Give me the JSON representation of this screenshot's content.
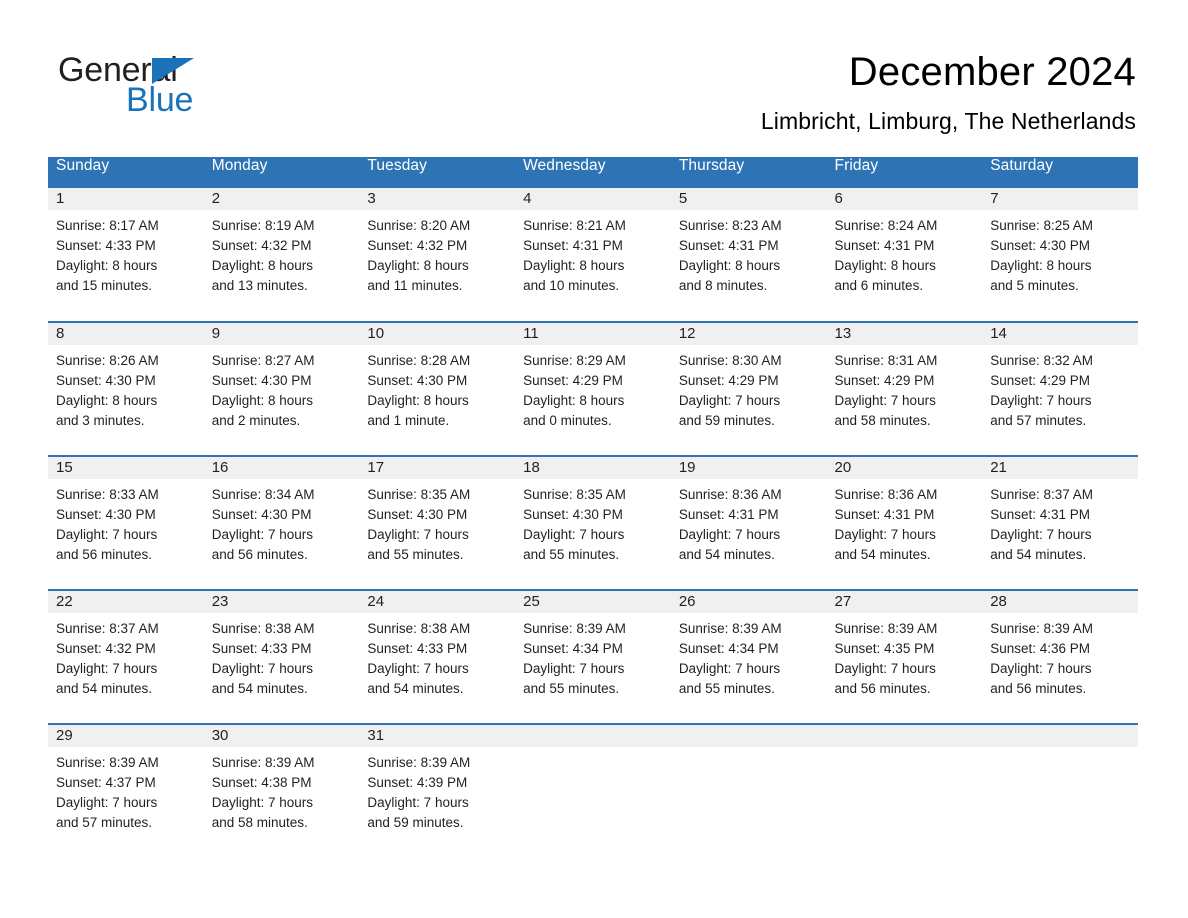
{
  "brand": {
    "name_part1": "General",
    "name_part2": "Blue",
    "triangle_color": "#1b72b8"
  },
  "header": {
    "title": "December 2024",
    "subtitle": "Limbricht, Limburg, The Netherlands"
  },
  "theme": {
    "header_blue": "#2e74b5",
    "daynum_band": "#f0f0f0",
    "text": "#231f20"
  },
  "calendar": {
    "weekday_headers": [
      "Sunday",
      "Monday",
      "Tuesday",
      "Wednesday",
      "Thursday",
      "Friday",
      "Saturday"
    ],
    "weeks": [
      [
        {
          "day": "1",
          "sunrise": "Sunrise: 8:17 AM",
          "sunset": "Sunset: 4:33 PM",
          "daylight_line1": "Daylight: 8 hours",
          "daylight_line2": "and 15 minutes."
        },
        {
          "day": "2",
          "sunrise": "Sunrise: 8:19 AM",
          "sunset": "Sunset: 4:32 PM",
          "daylight_line1": "Daylight: 8 hours",
          "daylight_line2": "and 13 minutes."
        },
        {
          "day": "3",
          "sunrise": "Sunrise: 8:20 AM",
          "sunset": "Sunset: 4:32 PM",
          "daylight_line1": "Daylight: 8 hours",
          "daylight_line2": "and 11 minutes."
        },
        {
          "day": "4",
          "sunrise": "Sunrise: 8:21 AM",
          "sunset": "Sunset: 4:31 PM",
          "daylight_line1": "Daylight: 8 hours",
          "daylight_line2": "and 10 minutes."
        },
        {
          "day": "5",
          "sunrise": "Sunrise: 8:23 AM",
          "sunset": "Sunset: 4:31 PM",
          "daylight_line1": "Daylight: 8 hours",
          "daylight_line2": "and 8 minutes."
        },
        {
          "day": "6",
          "sunrise": "Sunrise: 8:24 AM",
          "sunset": "Sunset: 4:31 PM",
          "daylight_line1": "Daylight: 8 hours",
          "daylight_line2": "and 6 minutes."
        },
        {
          "day": "7",
          "sunrise": "Sunrise: 8:25 AM",
          "sunset": "Sunset: 4:30 PM",
          "daylight_line1": "Daylight: 8 hours",
          "daylight_line2": "and 5 minutes."
        }
      ],
      [
        {
          "day": "8",
          "sunrise": "Sunrise: 8:26 AM",
          "sunset": "Sunset: 4:30 PM",
          "daylight_line1": "Daylight: 8 hours",
          "daylight_line2": "and 3 minutes."
        },
        {
          "day": "9",
          "sunrise": "Sunrise: 8:27 AM",
          "sunset": "Sunset: 4:30 PM",
          "daylight_line1": "Daylight: 8 hours",
          "daylight_line2": "and 2 minutes."
        },
        {
          "day": "10",
          "sunrise": "Sunrise: 8:28 AM",
          "sunset": "Sunset: 4:30 PM",
          "daylight_line1": "Daylight: 8 hours",
          "daylight_line2": "and 1 minute."
        },
        {
          "day": "11",
          "sunrise": "Sunrise: 8:29 AM",
          "sunset": "Sunset: 4:29 PM",
          "daylight_line1": "Daylight: 8 hours",
          "daylight_line2": "and 0 minutes."
        },
        {
          "day": "12",
          "sunrise": "Sunrise: 8:30 AM",
          "sunset": "Sunset: 4:29 PM",
          "daylight_line1": "Daylight: 7 hours",
          "daylight_line2": "and 59 minutes."
        },
        {
          "day": "13",
          "sunrise": "Sunrise: 8:31 AM",
          "sunset": "Sunset: 4:29 PM",
          "daylight_line1": "Daylight: 7 hours",
          "daylight_line2": "and 58 minutes."
        },
        {
          "day": "14",
          "sunrise": "Sunrise: 8:32 AM",
          "sunset": "Sunset: 4:29 PM",
          "daylight_line1": "Daylight: 7 hours",
          "daylight_line2": "and 57 minutes."
        }
      ],
      [
        {
          "day": "15",
          "sunrise": "Sunrise: 8:33 AM",
          "sunset": "Sunset: 4:30 PM",
          "daylight_line1": "Daylight: 7 hours",
          "daylight_line2": "and 56 minutes."
        },
        {
          "day": "16",
          "sunrise": "Sunrise: 8:34 AM",
          "sunset": "Sunset: 4:30 PM",
          "daylight_line1": "Daylight: 7 hours",
          "daylight_line2": "and 56 minutes."
        },
        {
          "day": "17",
          "sunrise": "Sunrise: 8:35 AM",
          "sunset": "Sunset: 4:30 PM",
          "daylight_line1": "Daylight: 7 hours",
          "daylight_line2": "and 55 minutes."
        },
        {
          "day": "18",
          "sunrise": "Sunrise: 8:35 AM",
          "sunset": "Sunset: 4:30 PM",
          "daylight_line1": "Daylight: 7 hours",
          "daylight_line2": "and 55 minutes."
        },
        {
          "day": "19",
          "sunrise": "Sunrise: 8:36 AM",
          "sunset": "Sunset: 4:31 PM",
          "daylight_line1": "Daylight: 7 hours",
          "daylight_line2": "and 54 minutes."
        },
        {
          "day": "20",
          "sunrise": "Sunrise: 8:36 AM",
          "sunset": "Sunset: 4:31 PM",
          "daylight_line1": "Daylight: 7 hours",
          "daylight_line2": "and 54 minutes."
        },
        {
          "day": "21",
          "sunrise": "Sunrise: 8:37 AM",
          "sunset": "Sunset: 4:31 PM",
          "daylight_line1": "Daylight: 7 hours",
          "daylight_line2": "and 54 minutes."
        }
      ],
      [
        {
          "day": "22",
          "sunrise": "Sunrise: 8:37 AM",
          "sunset": "Sunset: 4:32 PM",
          "daylight_line1": "Daylight: 7 hours",
          "daylight_line2": "and 54 minutes."
        },
        {
          "day": "23",
          "sunrise": "Sunrise: 8:38 AM",
          "sunset": "Sunset: 4:33 PM",
          "daylight_line1": "Daylight: 7 hours",
          "daylight_line2": "and 54 minutes."
        },
        {
          "day": "24",
          "sunrise": "Sunrise: 8:38 AM",
          "sunset": "Sunset: 4:33 PM",
          "daylight_line1": "Daylight: 7 hours",
          "daylight_line2": "and 54 minutes."
        },
        {
          "day": "25",
          "sunrise": "Sunrise: 8:39 AM",
          "sunset": "Sunset: 4:34 PM",
          "daylight_line1": "Daylight: 7 hours",
          "daylight_line2": "and 55 minutes."
        },
        {
          "day": "26",
          "sunrise": "Sunrise: 8:39 AM",
          "sunset": "Sunset: 4:34 PM",
          "daylight_line1": "Daylight: 7 hours",
          "daylight_line2": "and 55 minutes."
        },
        {
          "day": "27",
          "sunrise": "Sunrise: 8:39 AM",
          "sunset": "Sunset: 4:35 PM",
          "daylight_line1": "Daylight: 7 hours",
          "daylight_line2": "and 56 minutes."
        },
        {
          "day": "28",
          "sunrise": "Sunrise: 8:39 AM",
          "sunset": "Sunset: 4:36 PM",
          "daylight_line1": "Daylight: 7 hours",
          "daylight_line2": "and 56 minutes."
        }
      ],
      [
        {
          "day": "29",
          "sunrise": "Sunrise: 8:39 AM",
          "sunset": "Sunset: 4:37 PM",
          "daylight_line1": "Daylight: 7 hours",
          "daylight_line2": "and 57 minutes."
        },
        {
          "day": "30",
          "sunrise": "Sunrise: 8:39 AM",
          "sunset": "Sunset: 4:38 PM",
          "daylight_line1": "Daylight: 7 hours",
          "daylight_line2": "and 58 minutes."
        },
        {
          "day": "31",
          "sunrise": "Sunrise: 8:39 AM",
          "sunset": "Sunset: 4:39 PM",
          "daylight_line1": "Daylight: 7 hours",
          "daylight_line2": "and 59 minutes."
        },
        {
          "day": "",
          "sunrise": "",
          "sunset": "",
          "daylight_line1": "",
          "daylight_line2": ""
        },
        {
          "day": "",
          "sunrise": "",
          "sunset": "",
          "daylight_line1": "",
          "daylight_line2": ""
        },
        {
          "day": "",
          "sunrise": "",
          "sunset": "",
          "daylight_line1": "",
          "daylight_line2": ""
        },
        {
          "day": "",
          "sunrise": "",
          "sunset": "",
          "daylight_line1": "",
          "daylight_line2": ""
        }
      ]
    ]
  }
}
